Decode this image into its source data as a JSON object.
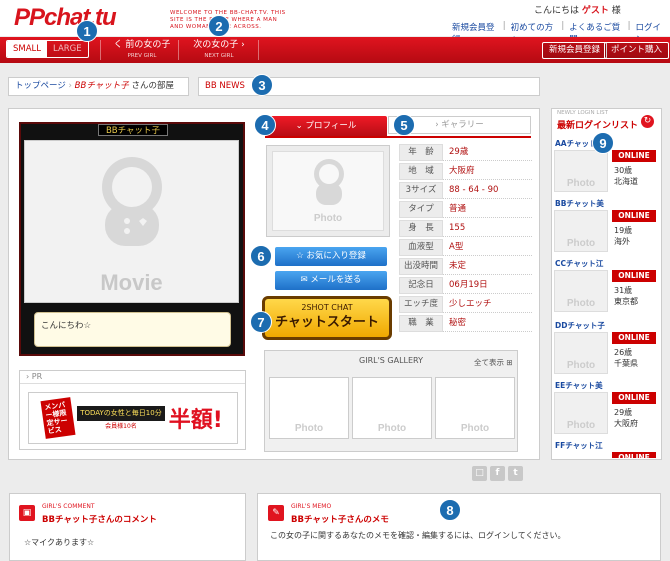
{
  "header": {
    "logo": "PPchat.tu",
    "slogan": "WELCOME TO THE BB-CHAT.TV. THIS SITE IS THE PLACE WHERE A MAN AND WOMAN COME ACROSS.",
    "welcome_prefix": "こんにちは",
    "welcome_name": "ゲスト",
    "welcome_suffix": "様",
    "links": [
      "新規会員登録",
      "初めての方へ",
      "よくあるご質問",
      "ログイン"
    ]
  },
  "nav": {
    "size_small": "SMALL",
    "size_large": "LARGE",
    "prev": "く 前の女の子",
    "prev_sub": "PREV GIRL",
    "next": "次の女の子 ›",
    "next_sub": "NEXT GIRL",
    "register": "新規会員登録",
    "points": "ポイント購入"
  },
  "breadcrumb": {
    "home": "トップページ",
    "girl": "BBチャット子",
    "suffix": "さんの部屋"
  },
  "news": "BB NEWS",
  "room": {
    "name": "BBチャット子",
    "movie": "Movie",
    "bubble": "こんにちわ☆",
    "pr_label": "PR"
  },
  "banner": {
    "badge": "メンバー様限定サービス",
    "text": "TODAYの女性と毎日10分",
    "sub": "会員様10名",
    "half": "半額!"
  },
  "tabs": {
    "profile": "プロフィール",
    "gallery": "ギャラリー"
  },
  "photo_label": "Photo",
  "buttons": {
    "favorite": "☆ お気に入り登録",
    "mail": "✉ メールを送る",
    "chat_top": "2SHOT CHAT",
    "chat_main": "チャットスタート"
  },
  "profile": [
    {
      "k": "年　齢",
      "v": "29歳"
    },
    {
      "k": "地　域",
      "v": "大阪府"
    },
    {
      "k": "3サイズ",
      "v": "88 - 64 - 90"
    },
    {
      "k": "タイプ",
      "v": "普通"
    },
    {
      "k": "身　長",
      "v": "155"
    },
    {
      "k": "血液型",
      "v": "A型"
    },
    {
      "k": "出没時間",
      "v": "未定"
    },
    {
      "k": "記念日",
      "v": "06月19日"
    },
    {
      "k": "エッチ度",
      "v": "少しエッチ"
    },
    {
      "k": "職　業",
      "v": "秘密"
    }
  ],
  "gallery": {
    "title": "GIRL'S GALLERY",
    "all": "全て表示 ⊞"
  },
  "side": {
    "title_en": "NEWLY LOGIN LIST",
    "title": "最新ログインリスト",
    "status": "ONLINE",
    "items": [
      {
        "name": "AAチャット子",
        "age": "30歳",
        "area": "北海道"
      },
      {
        "name": "BBチャット美",
        "age": "19歳",
        "area": "海外"
      },
      {
        "name": "CCチャット江",
        "age": "31歳",
        "area": "東京都"
      },
      {
        "name": "DDチャット子",
        "age": "26歳",
        "area": "千葉県"
      },
      {
        "name": "EEチャット美",
        "age": "29歳",
        "area": "大阪府"
      },
      {
        "name": "FFチャット江",
        "age": "",
        "area": ""
      }
    ]
  },
  "comment": {
    "sub": "GIRL'S COMMENT",
    "title": "BBチャット子さんのコメント",
    "text": "☆マイクあります☆"
  },
  "memo": {
    "sub": "GIRL'S MEMO",
    "title": "BBチャット子さんのメモ",
    "text": "この女の子に関するあなたのメモを確認・編集するには、ログインしてください。"
  },
  "numbers": [
    "1",
    "2",
    "3",
    "4",
    "5",
    "6",
    "7",
    "8",
    "9"
  ],
  "colors": {
    "brand_red": "#e0141f",
    "marker_blue": "#1c6cb0",
    "chat_yellow": "#f0a800"
  }
}
